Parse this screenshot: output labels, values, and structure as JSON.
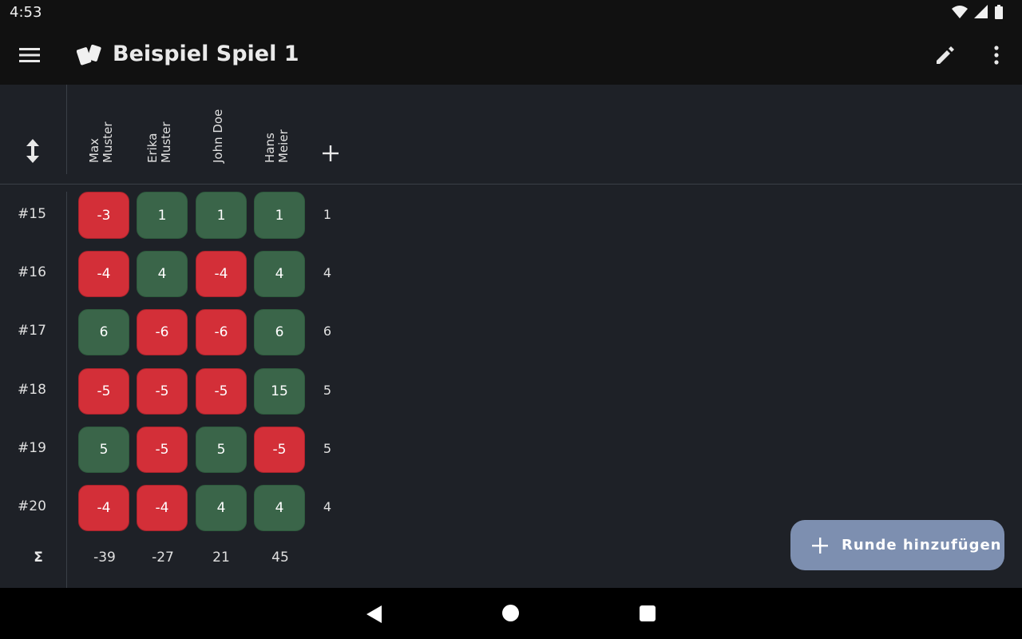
{
  "status_bar": {
    "time": "4:53"
  },
  "app_bar": {
    "title": "Beispiel Spiel 1"
  },
  "players": [
    {
      "name": "Max\nMuster"
    },
    {
      "name": "Erika\nMuster"
    },
    {
      "name": "John Doe"
    },
    {
      "name": "Hans\nMeier"
    }
  ],
  "rounds": [
    {
      "label": "#15",
      "scores": [
        "-3",
        "1",
        "1",
        "1"
      ],
      "value": "1"
    },
    {
      "label": "#16",
      "scores": [
        "-4",
        "4",
        "-4",
        "4"
      ],
      "value": "4"
    },
    {
      "label": "#17",
      "scores": [
        "6",
        "-6",
        "-6",
        "6"
      ],
      "value": "6"
    },
    {
      "label": "#18",
      "scores": [
        "-5",
        "-5",
        "-5",
        "15"
      ],
      "value": "5"
    },
    {
      "label": "#19",
      "scores": [
        "5",
        "-5",
        "5",
        "-5"
      ],
      "value": "5"
    },
    {
      "label": "#20",
      "scores": [
        "-4",
        "-4",
        "4",
        "4"
      ],
      "value": "4"
    }
  ],
  "totals": {
    "label": "Σ",
    "values": [
      "-39",
      "-27",
      "21",
      "45"
    ]
  },
  "fab": {
    "label": "Runde hinzufügen"
  },
  "colors": {
    "negative": "#d32f38",
    "positive": "#3a6549",
    "fab": "#7d8fb0"
  },
  "icons": [
    "menu-icon",
    "cards-logo-icon",
    "edit-icon",
    "more-vert-icon",
    "sort-icon",
    "add-icon",
    "back-icon",
    "home-icon",
    "recents-icon"
  ]
}
